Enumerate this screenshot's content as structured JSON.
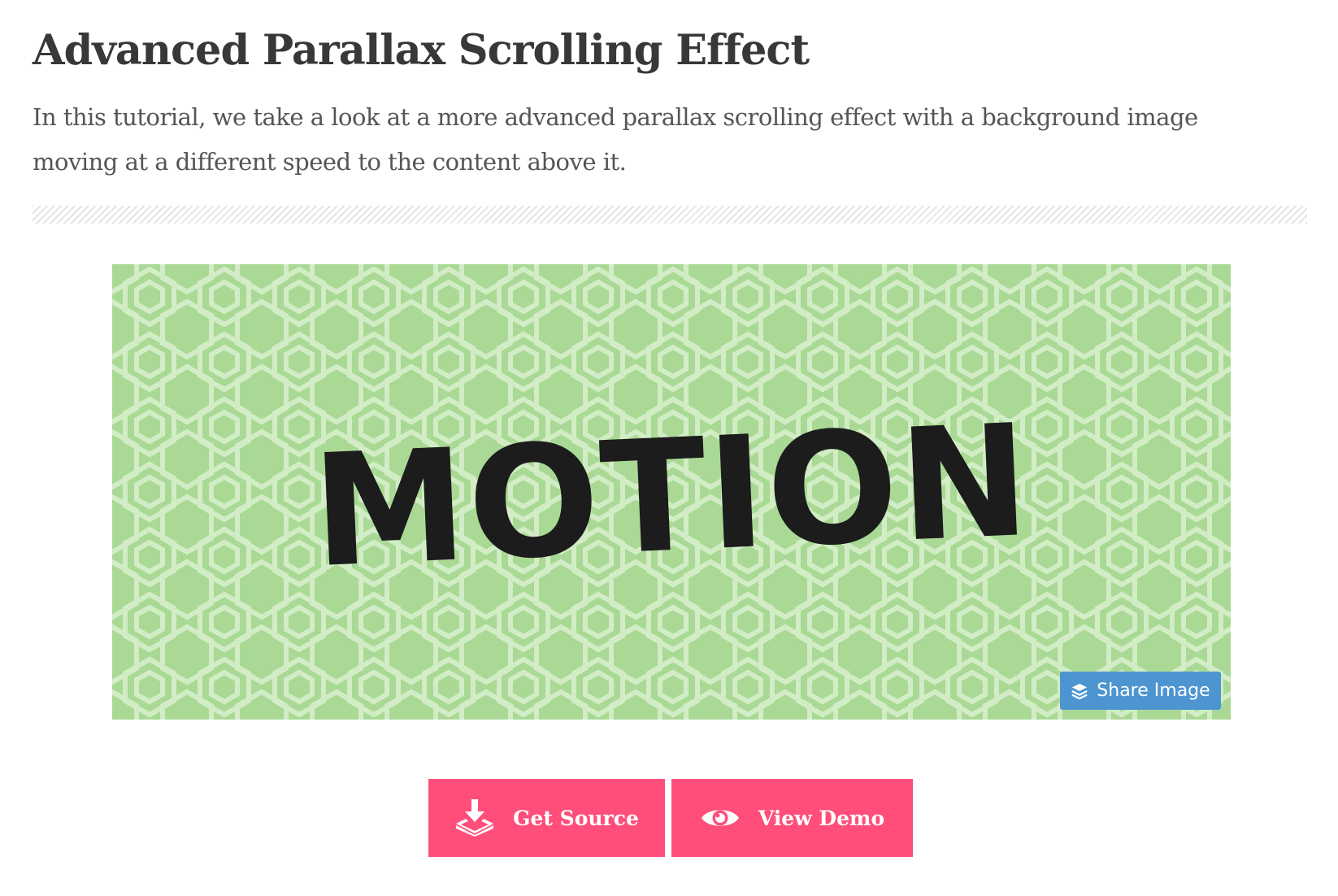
{
  "article": {
    "title": "Advanced Parallax Scrolling Effect",
    "description": "In this tutorial, we take a look at a more advanced parallax scrolling effect with a background image moving at a different speed to the content above it."
  },
  "hero": {
    "word": "MOTION",
    "share_label": "Share Image"
  },
  "actions": {
    "get_source_label": "Get Source",
    "view_demo_label": "View Demo"
  },
  "icons": {
    "share": "layers-icon",
    "source": "download-icon",
    "demo": "eye-icon"
  },
  "colors": {
    "accent": "#ff4e7a",
    "share_button": "#4d95d1",
    "hero_background": "#a9d995",
    "hero_pattern": "#d2edc5",
    "title_text": "#383838",
    "body_text": "#555555"
  }
}
